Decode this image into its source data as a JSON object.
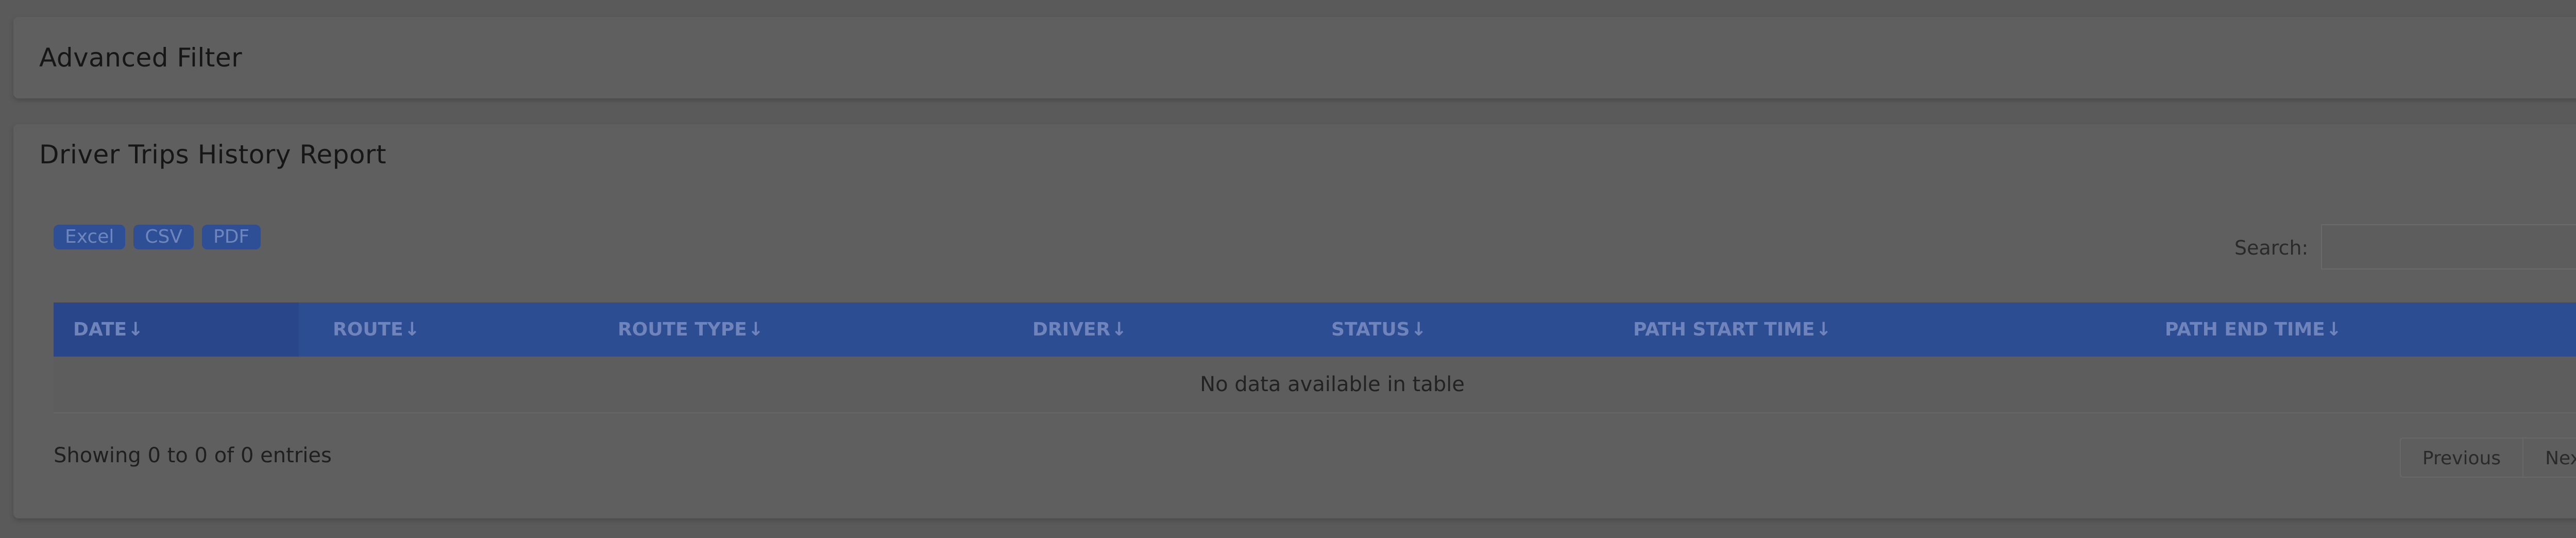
{
  "filter_panel": {
    "title": "Advanced Filter",
    "filter_icon": "filter-icon",
    "accent_color": "#2f66e8"
  },
  "report": {
    "title": "Driver Trips History Report",
    "export_buttons": [
      "Excel",
      "CSV",
      "PDF"
    ],
    "search": {
      "label": "Search:",
      "value": "",
      "placeholder": ""
    },
    "columns": [
      {
        "label": "DATE",
        "sort": "↓"
      },
      {
        "label": "ROUTE",
        "sort": "↓"
      },
      {
        "label": "ROUTE TYPE",
        "sort": "↓"
      },
      {
        "label": "DRIVER",
        "sort": "↓"
      },
      {
        "label": "STATUS",
        "sort": "↓"
      },
      {
        "label": "PATH START TIME",
        "sort": "↓"
      },
      {
        "label": "PATH END TIME",
        "sort": "↓"
      }
    ],
    "empty_message": "No data available in table",
    "info": "Showing 0 to 0 of 0 entries",
    "pagination": {
      "previous": "Previous",
      "next": "Next"
    },
    "header_color": "#2d4d93"
  }
}
